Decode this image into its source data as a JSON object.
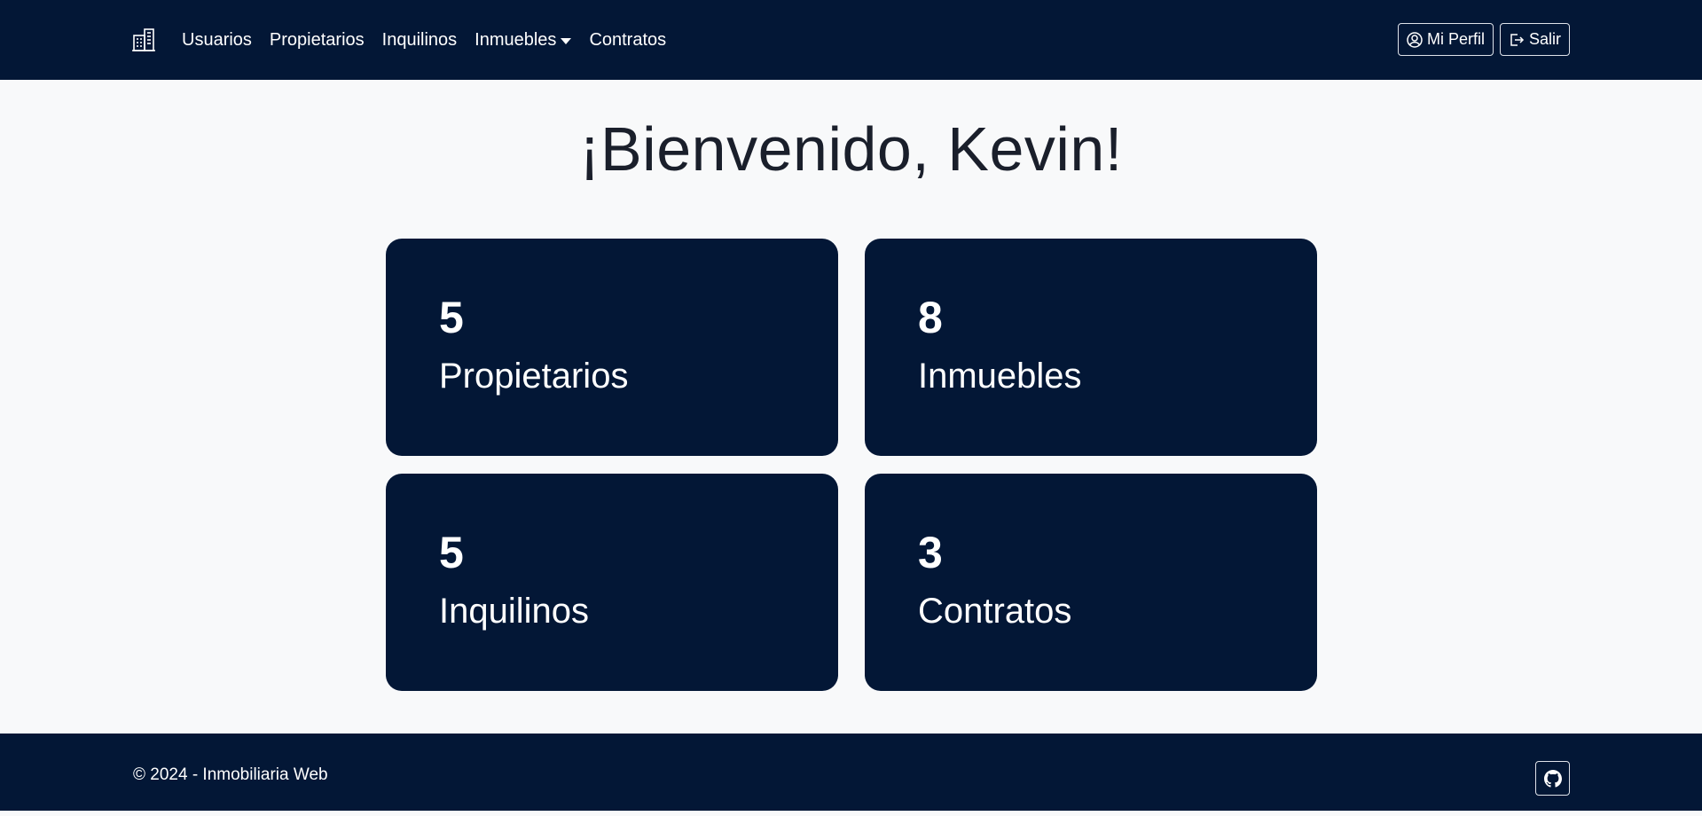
{
  "nav": {
    "brand_icon": "building-icon",
    "links": [
      {
        "label": "Usuarios"
      },
      {
        "label": "Propietarios"
      },
      {
        "label": "Inquilinos"
      },
      {
        "label": "Inmuebles"
      },
      {
        "label": "Contratos"
      }
    ],
    "profile_label": "Mi Perfil",
    "profile_icon": "user-circle-icon",
    "logout_label": "Salir",
    "logout_icon": "logout-icon"
  },
  "main": {
    "welcome": "¡Bienvenido, Kevin!",
    "cards": [
      {
        "count": "5",
        "label": "Propietarios"
      },
      {
        "count": "8",
        "label": "Inmuebles"
      },
      {
        "count": "5",
        "label": "Inquilinos"
      },
      {
        "count": "3",
        "label": "Contratos"
      }
    ]
  },
  "footer": {
    "copyright": "© 2024 - Inmobiliaria Web",
    "github_icon": "github-icon"
  },
  "colors": {
    "navy": "#031736",
    "background": "#f8f9fa",
    "text_dark": "#1a1f2b",
    "white": "#ffffff"
  }
}
